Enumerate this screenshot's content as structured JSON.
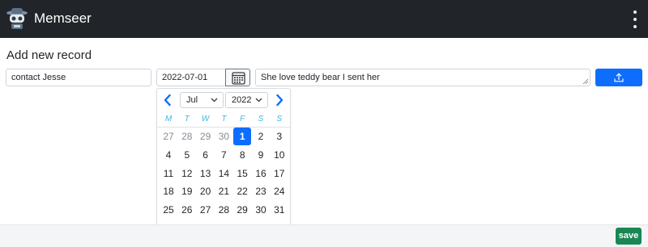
{
  "app": {
    "title": "Memseer",
    "logo_icon": "robot-mascot-icon",
    "menu_icon": "kebab-menu-icon"
  },
  "page": {
    "title": "Add new record"
  },
  "form": {
    "contact": "contact Jesse",
    "date": "2022-07-01",
    "calendar_icon": "calendar-icon",
    "note": "She love teddy bear I sent her",
    "upload_icon": "upload-icon",
    "upload_color": "#0d6efd"
  },
  "datepicker": {
    "month": "Jul",
    "year": "2022",
    "weekdays": [
      "M",
      "T",
      "W",
      "T",
      "F",
      "S",
      "S"
    ],
    "weekday_color": "#3db6e3",
    "selected_color": "#0d6efd",
    "weeks": [
      [
        "27",
        "28",
        "29",
        "30",
        "1",
        "2",
        "3"
      ],
      [
        "4",
        "5",
        "6",
        "7",
        "8",
        "9",
        "10"
      ],
      [
        "11",
        "12",
        "13",
        "14",
        "15",
        "16",
        "17"
      ],
      [
        "18",
        "19",
        "20",
        "21",
        "22",
        "23",
        "24"
      ],
      [
        "25",
        "26",
        "27",
        "28",
        "29",
        "30",
        "31"
      ]
    ],
    "selected_day": "1"
  },
  "footer": {
    "save_label": "save",
    "save_color": "#198754"
  }
}
